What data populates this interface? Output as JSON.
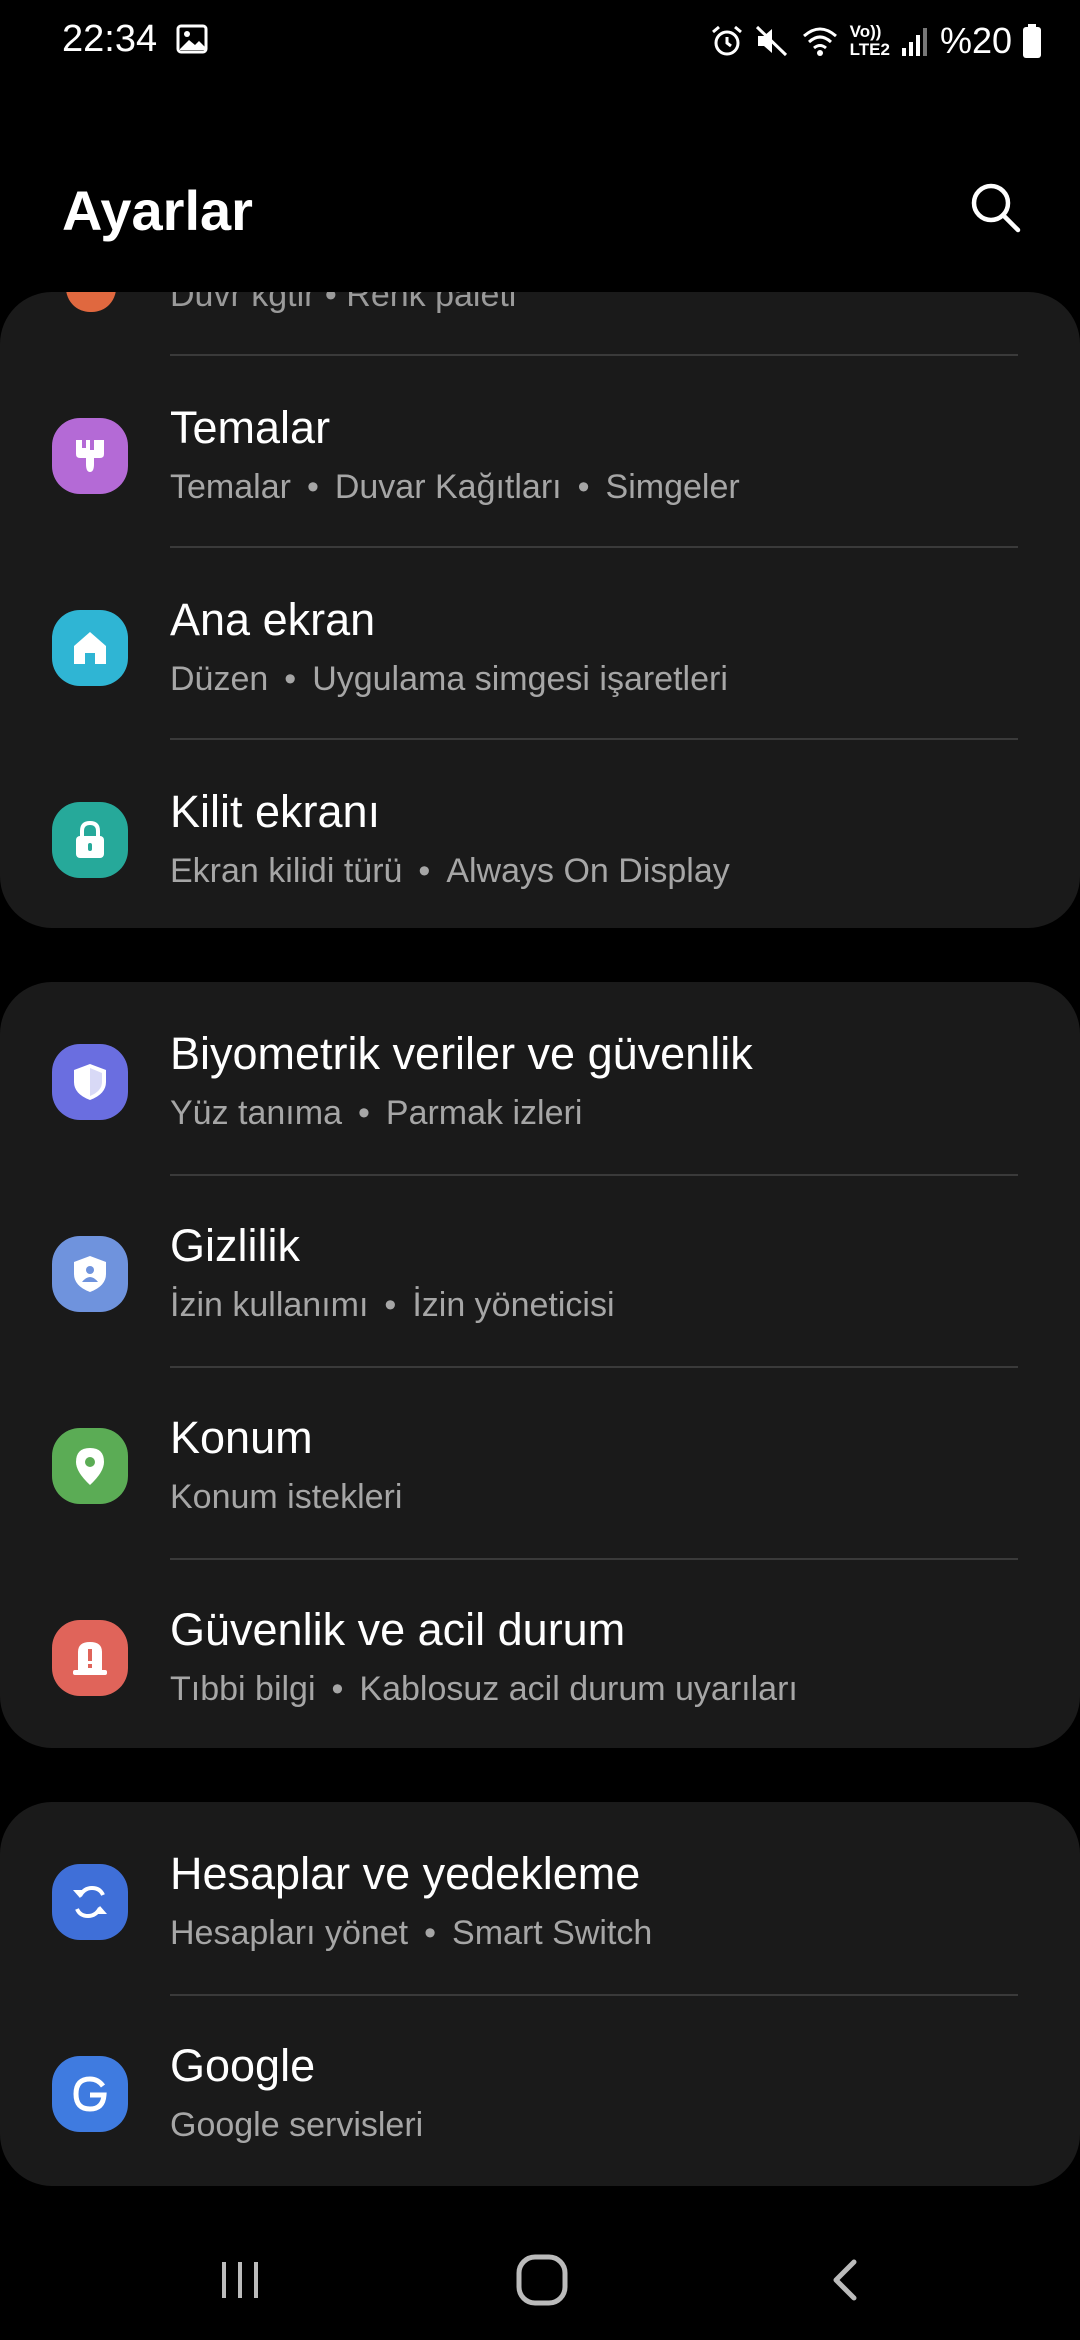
{
  "status_bar": {
    "time": "22:34",
    "network_label_top": "Vo))",
    "network_label_bottom": "LTE2",
    "battery": "%20"
  },
  "header": {
    "title": "Ayarlar",
    "search_icon": "search-icon"
  },
  "partial_row": {
    "subtitle": "Duvr kgtlr • Renk paleti"
  },
  "groups": [
    {
      "items": [
        {
          "title": "Temalar",
          "subs": [
            "Temalar",
            "Duvar Kağıtları",
            "Simgeler"
          ],
          "icon": "brush-icon",
          "color": "#b46ad6"
        },
        {
          "title": "Ana ekran",
          "subs": [
            "Düzen",
            "Uygulama simgesi işaretleri"
          ],
          "icon": "home-icon",
          "color": "#2fb5d4"
        },
        {
          "title": "Kilit ekranı",
          "subs": [
            "Ekran kilidi türü",
            "Always On Display"
          ],
          "icon": "lock-icon",
          "color": "#26a99a"
        }
      ]
    },
    {
      "items": [
        {
          "title": "Biyometrik veriler ve güvenlik",
          "subs": [
            "Yüz tanıma",
            "Parmak izleri"
          ],
          "icon": "shield-icon",
          "color": "#6a6ee0"
        },
        {
          "title": "Gizlilik",
          "subs": [
            "İzin kullanımı",
            "İzin yöneticisi"
          ],
          "icon": "privacy-shield-icon",
          "color": "#6f93dd"
        },
        {
          "title": "Konum",
          "subs": [
            "Konum istekleri"
          ],
          "icon": "location-pin-icon",
          "color": "#5bac55"
        },
        {
          "title": "Güvenlik ve acil durum",
          "subs": [
            "Tıbbi bilgi",
            "Kablosuz acil durum uyarıları"
          ],
          "icon": "emergency-alert-icon",
          "color": "#e0645a"
        }
      ]
    },
    {
      "items": [
        {
          "title": "Hesaplar ve yedekleme",
          "subs": [
            "Hesapları yönet",
            "Smart Switch"
          ],
          "icon": "sync-icon",
          "color": "#3f6fd8"
        },
        {
          "title": "Google",
          "subs": [
            "Google servisleri"
          ],
          "icon": "google-icon",
          "color": "#3f7be0"
        }
      ]
    }
  ],
  "nav_bar": {
    "recents_icon": "recents-icon",
    "home_icon": "home-button-icon",
    "back_icon": "back-icon"
  }
}
